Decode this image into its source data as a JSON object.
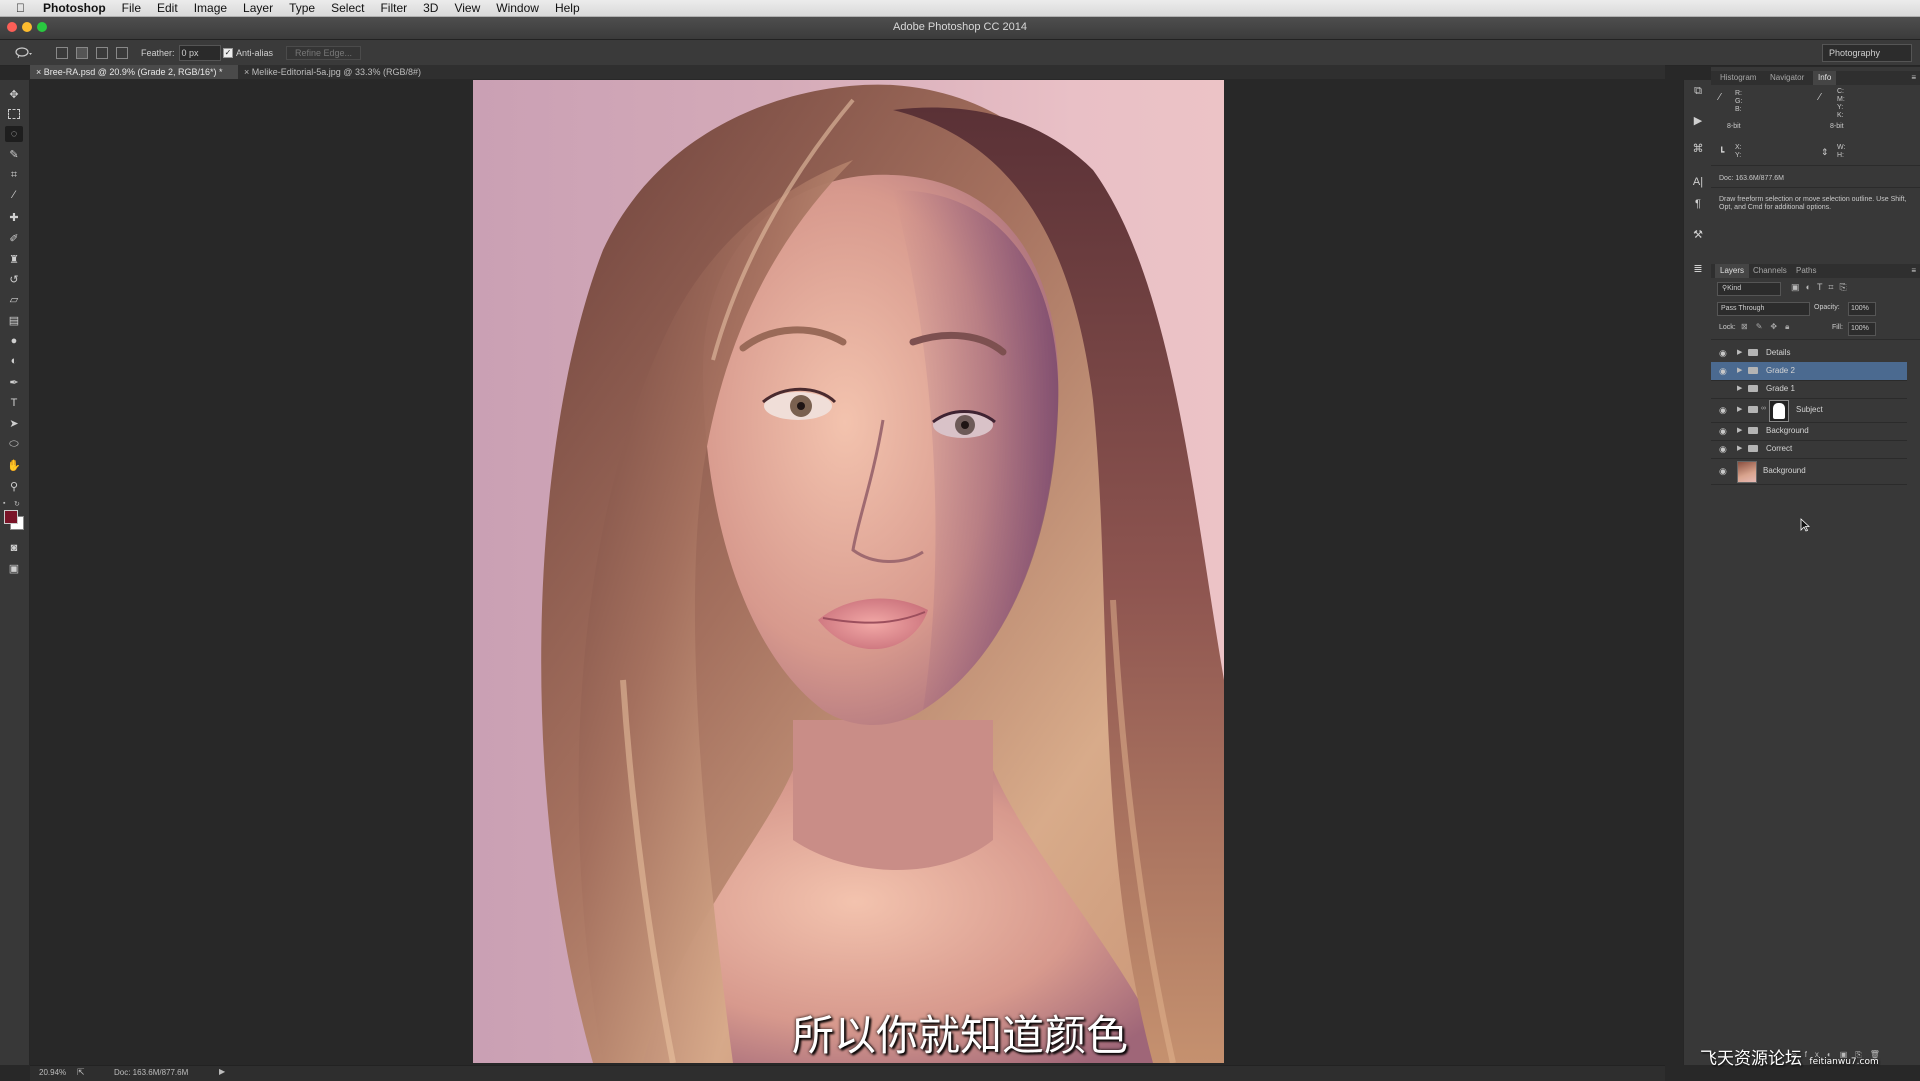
{
  "menubar": {
    "app_name": "Photoshop",
    "items": [
      "File",
      "Edit",
      "Image",
      "Layer",
      "Type",
      "Select",
      "Filter",
      "3D",
      "View",
      "Window",
      "Help"
    ]
  },
  "window": {
    "title": "Adobe Photoshop CC 2014"
  },
  "options_bar": {
    "feather_label": "Feather:",
    "feather_value": "0 px",
    "antialias_label": "Anti-alias",
    "refine_edge_label": "Refine Edge...",
    "workspace": "Photography"
  },
  "document_tabs": [
    {
      "label": "Bree-RA.psd @ 20.9% (Grade 2, RGB/16*) *",
      "active": true
    },
    {
      "label": "Melike-Editorial-5a.jpg @ 33.3% (RGB/8#)",
      "active": false
    }
  ],
  "status_bar": {
    "zoom": "20.94%",
    "doc_size": "Doc: 163.6M/877.6M"
  },
  "info_panel": {
    "tabs": [
      "Histogram",
      "Navigator",
      "Info"
    ],
    "active_tab": "Info",
    "rgb_labels": [
      "R:",
      "G:",
      "B:"
    ],
    "cmyk_labels": [
      "C:",
      "M:",
      "Y:",
      "K:"
    ],
    "bitdepth_left": "8-bit",
    "bitdepth_right": "8-bit",
    "xy_labels": [
      "X:",
      "Y:"
    ],
    "wh_labels": [
      "W:",
      "H:"
    ],
    "doc_size": "Doc: 163.6M/877.6M",
    "hint": "Draw freeform selection or move selection outline. Use Shift, Opt, and Cmd for additional options."
  },
  "layers_panel": {
    "tabs": [
      "Layers",
      "Channels",
      "Paths"
    ],
    "active_tab": "Layers",
    "filter_kind": "Kind",
    "blend_mode": "Pass Through",
    "opacity_label": "Opacity:",
    "opacity_value": "100%",
    "lock_label": "Lock:",
    "fill_label": "Fill:",
    "fill_value": "100%",
    "layers": [
      {
        "name": "Details",
        "type": "group",
        "visible": true,
        "selected": false
      },
      {
        "name": "Grade 2",
        "type": "group",
        "visible": true,
        "selected": true
      },
      {
        "name": "Grade 1",
        "type": "group",
        "visible": false,
        "selected": false
      },
      {
        "name": "Subject",
        "type": "group-mask",
        "visible": true,
        "selected": false
      },
      {
        "name": "Background",
        "type": "group",
        "visible": true,
        "selected": false
      },
      {
        "name": "Correct",
        "type": "group",
        "visible": true,
        "selected": false
      },
      {
        "name": "Background",
        "type": "image",
        "visible": true,
        "selected": false
      }
    ]
  },
  "subtitle": "所以你就知道颜色",
  "watermark": "飞天资源论坛",
  "watermark_url": "feitianwu7.com",
  "colors": {
    "foreground": "#7a1428",
    "background": "#ffffff",
    "selected_layer": "#4b6a90"
  }
}
